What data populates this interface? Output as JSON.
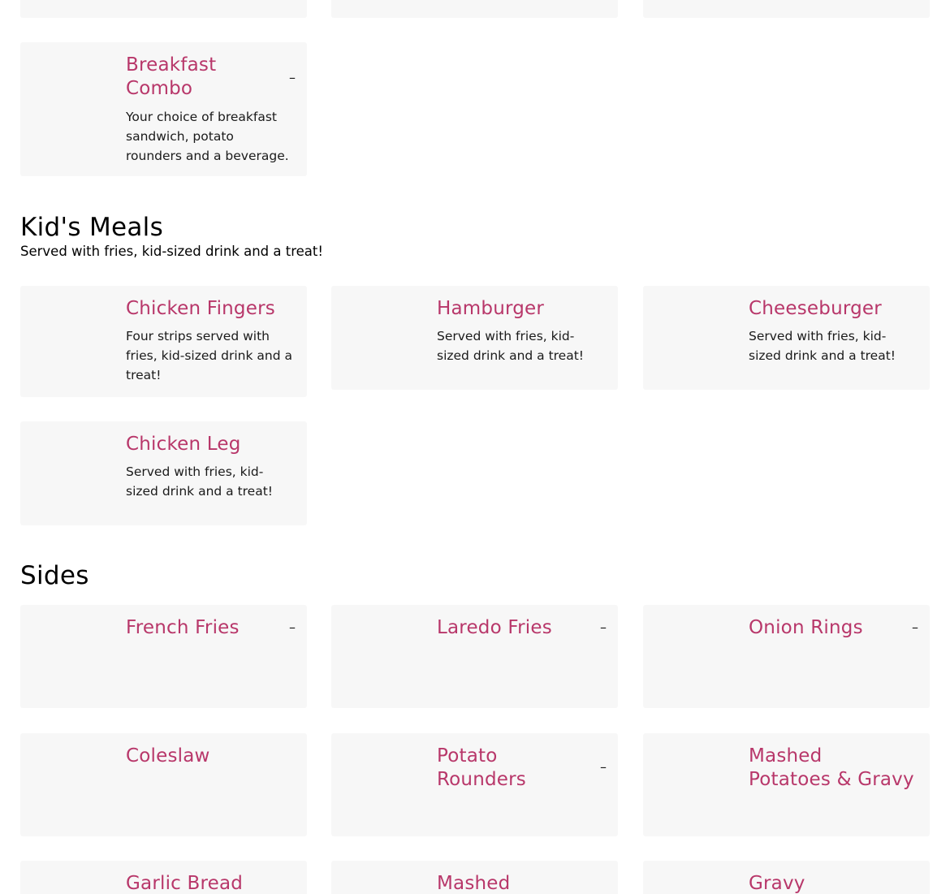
{
  "breakfast_combo": {
    "name": "Breakfast Combo",
    "name_line1": "Breakfast",
    "name_line2": "Combo",
    "desc_lines": [
      "Your choice of breakfast",
      "sandwich, potato",
      "rounders and a beverage."
    ],
    "toggle": "–"
  },
  "kids_meals": {
    "title": "Kid's Meals",
    "subtitle": "Served with fries, kid-sized drink and a treat!",
    "items": [
      {
        "name": "Chicken Fingers",
        "desc_lines": [
          "Four strips served with",
          "fries, kid-sized drink and a",
          "treat!"
        ]
      },
      {
        "name": "Hamburger",
        "desc_lines": [
          "Served with fries, kid-",
          "sized drink and a treat!"
        ]
      },
      {
        "name": "Cheeseburger",
        "desc_lines": [
          "Served with fries, kid-",
          "sized drink and a treat!"
        ]
      },
      {
        "name": "Chicken Leg",
        "desc_lines": [
          "Served with fries, kid-",
          "sized drink and a treat!"
        ]
      }
    ]
  },
  "sides": {
    "title": "Sides",
    "items": [
      {
        "name": "French Fries",
        "toggle": "–"
      },
      {
        "name": "Laredo Fries",
        "toggle": "–"
      },
      {
        "name": "Onion Rings",
        "toggle": "–"
      },
      {
        "name": "Coleslaw"
      },
      {
        "name_line1": "Potato",
        "name_line2": "Rounders",
        "toggle": "–"
      },
      {
        "name_line1": "Mashed",
        "name_line2": "Potatoes & Gravy"
      },
      {
        "name": "Garlic Bread"
      },
      {
        "name": "Mashed"
      },
      {
        "name": "Gravy"
      }
    ]
  },
  "colors": {
    "accent": "#b8376a",
    "card_bg": "#f7f7f7"
  }
}
